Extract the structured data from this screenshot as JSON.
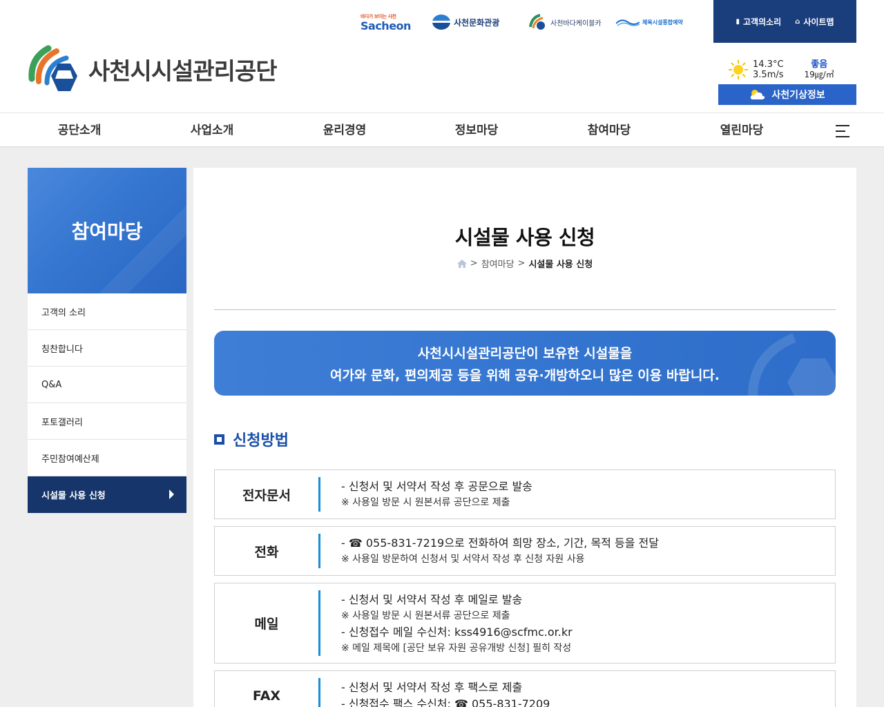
{
  "header": {
    "partners": {
      "sacheon_small": "바다가 보이는 사천",
      "sacheon": "Sacheon",
      "culture": "사천문화관광",
      "cablecar": "사천바다케이블카",
      "sports": "체육시설통합예약"
    },
    "util": {
      "voice": "고객의소리",
      "sitemap": "사이트맵"
    },
    "logo_text": "사천시시설관리공단",
    "weather": {
      "temp": "14.3°C",
      "wind": "3.5m/s",
      "air_grade": "좋음",
      "air_value": "19㎍/㎥",
      "button": "사천기상정보"
    },
    "gnb": [
      "공단소개",
      "사업소개",
      "윤리경영",
      "정보마당",
      "참여마당",
      "열린마당"
    ]
  },
  "lnb": {
    "title": "참여마당",
    "items": [
      "고객의 소리",
      "칭찬합니다",
      "Q&A",
      "포토갤러리",
      "주민참여예산제",
      "시설물 사용 신청"
    ]
  },
  "content": {
    "title": "시설물 사용 신청",
    "breadcrumb": {
      "sep1": ">",
      "parent": "참여마당",
      "sep2": ">",
      "current": "시설물 사용 신청"
    },
    "banner": {
      "line1": "사천시시설관리공단이 보유한 시설물을",
      "line2": "여가와 문화, 편의제공 등을 위해 공유·개방하오니 많은 이용 바랍니다."
    },
    "section_title": "신청방법",
    "methods": [
      {
        "label": "전자문서",
        "lines": [
          "- 신청서 및 서약서 작성 후 공문으로 발송",
          "※ 사용일 방문 시 원본서류 공단으로 제출"
        ]
      },
      {
        "label": "전화",
        "lines": [
          "- ☎ 055-831-7219으로 전화하여 희망 장소, 기간, 목적 등을 전달",
          "※ 사용일 방문하여 신청서 및 서약서 작성 후 신청 자원 사용"
        ]
      },
      {
        "label": "메일",
        "lines": [
          "- 신청서 및 서약서 작성 후 메일로 발송",
          "※ 사용일 방문 시 원본서류 공단으로 제출",
          "- 신청접수 메일 수신처: kss4916@scfmc.or.kr",
          "※ 메일 제목에 [공단 보유 자원 공유개방 신청] 필히 작성"
        ]
      },
      {
        "label": "FAX",
        "lines": [
          "- 신청서 및 서약서 작성 후 팩스로 제출",
          "- 신청접수 팩스 수신처: ☎ 055-831-7209"
        ]
      }
    ]
  },
  "colors": {
    "util_bg": "#1a3d7c",
    "accent": "#1a4fa8",
    "banner": "#3374cf",
    "active_menu": "#16356a",
    "method_bar": "#1a8cd8"
  }
}
